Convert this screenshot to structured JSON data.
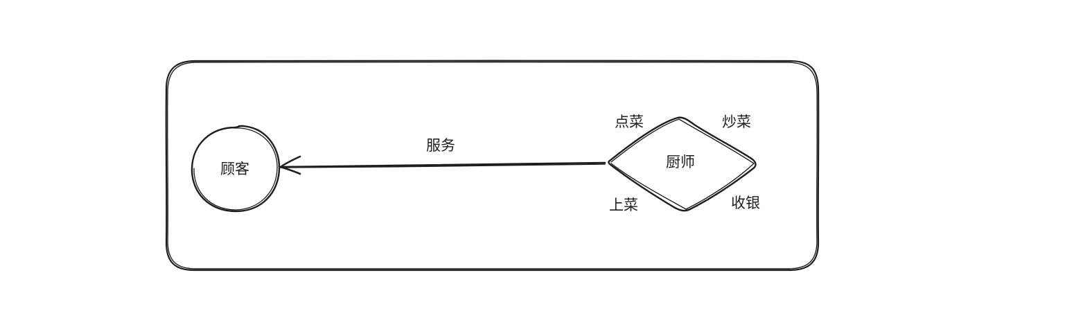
{
  "diagram": {
    "customer_label": "顾客",
    "chef_label": "厨师",
    "service_label": "服务",
    "order_label": "点菜",
    "cook_label": "炒菜",
    "serve_label": "上菜",
    "checkout_label": "收银",
    "stroke_color": "#1e1e1e",
    "background_color": "#ffffff"
  }
}
